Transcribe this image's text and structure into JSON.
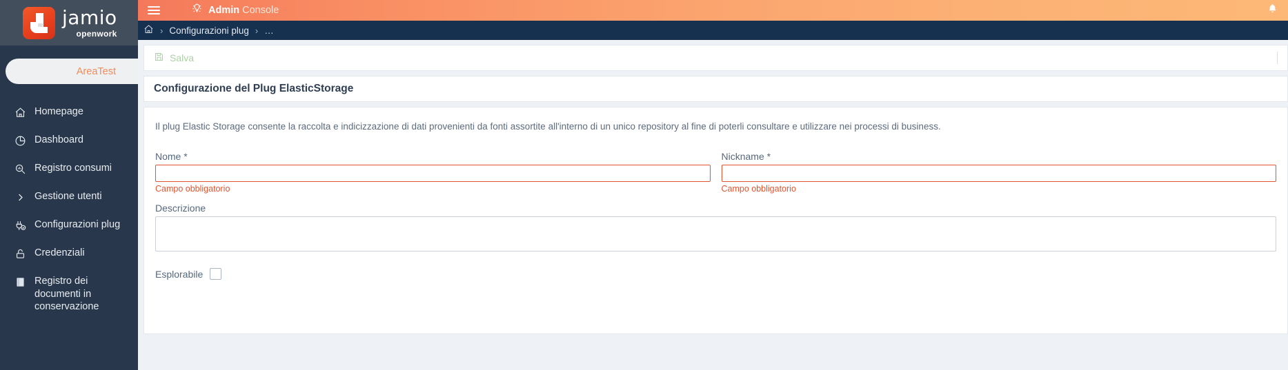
{
  "brand": {
    "logo_text_top": "jamio",
    "logo_text_bottom": "openwork",
    "area_label": "AreaTest"
  },
  "topbar": {
    "title_bold": "Admin",
    "title_light": "Console",
    "menu_icon": "hamburger-icon",
    "console_icon": "gear-lightbulb-icon",
    "notification_icon": "bell-icon"
  },
  "breadcrumb": {
    "home_icon": "home-icon",
    "separator": "›",
    "items": [
      {
        "label": "Configurazioni plug"
      },
      {
        "label": "…"
      }
    ]
  },
  "sidebar": {
    "items": [
      {
        "label": "Homepage",
        "icon": "home-icon"
      },
      {
        "label": "Dashboard",
        "icon": "pie-chart-icon"
      },
      {
        "label": "Registro consumi",
        "icon": "search-chart-icon"
      },
      {
        "label": "Gestione utenti",
        "icon": "chevron-right-icon"
      },
      {
        "label": "Configurazioni plug",
        "icon": "plug-check-icon"
      },
      {
        "label": "Credenziali",
        "icon": "lock-icon"
      },
      {
        "label": "Registro dei documenti in conservazione",
        "icon": "book-icon"
      }
    ]
  },
  "toolbar": {
    "save_label": "Salva",
    "save_icon": "floppy-disk-icon"
  },
  "page": {
    "title": "Configurazione del Plug ElasticStorage",
    "lead": "Il plug Elastic Storage consente la raccolta e indicizzazione di dati provenienti da fonti assortite all'interno di un unico repository al fine di poterli consultare e utilizzare nei processi di business."
  },
  "form": {
    "nome": {
      "label": "Nome *",
      "value": "",
      "placeholder": "",
      "error": "Campo obbligatorio"
    },
    "nickname": {
      "label": "Nickname *",
      "value": "",
      "placeholder": "",
      "error": "Campo obbligatorio"
    },
    "descrizione": {
      "label": "Descrizione",
      "value": "",
      "placeholder": ""
    },
    "esplorabile": {
      "label": "Esplorabile",
      "checked": false
    }
  },
  "colors": {
    "accent_orange": "#f15a29",
    "topbar_gradient_start": "#f4795b",
    "topbar_gradient_end": "#fdb877",
    "sidebar_bg": "#28374b",
    "breadcrumb_bg": "#16304f",
    "error_red": "#e0542f",
    "save_green": "#a8cfa0"
  }
}
